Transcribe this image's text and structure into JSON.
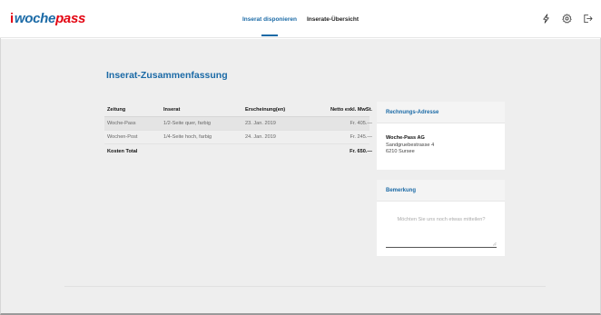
{
  "brand": {
    "prefix": "i",
    "part1": "woche",
    "part2": "pass"
  },
  "nav": {
    "tabs": [
      {
        "label": "Inserat disponieren",
        "active": true
      },
      {
        "label": "Inserate-Übersicht",
        "active": false
      }
    ]
  },
  "header_icons": [
    "lightning-icon",
    "gear-icon",
    "logout-icon"
  ],
  "page": {
    "title": "Inserat-Zusammenfassung"
  },
  "summary": {
    "headers": [
      "Zeitung",
      "Inserat",
      "Erscheinung(en)",
      "Netto exkl. MwSt."
    ],
    "rows": [
      {
        "zeitung": "Woche-Pass",
        "inserat": "1/2-Seite quer, farbig",
        "erscheinung": "23. Jan. 2019",
        "netto": "Fr. 405.—"
      },
      {
        "zeitung": "Wochen-Post",
        "inserat": "1/4-Seite hoch, farbig",
        "erscheinung": "24. Jan. 2019",
        "netto": "Fr. 245.—"
      }
    ],
    "total_label": "Kosten Total",
    "total_value": "Fr. 650.—"
  },
  "billing": {
    "title": "Rechnungs-Adresse",
    "company": "Woche-Pass AG",
    "street": "Sandgruebestrasse 4",
    "city": "6210 Sursee"
  },
  "remark": {
    "title": "Bemerkung",
    "placeholder": "Möchten Sie uns noch etwas mitteilen?",
    "value": ""
  },
  "colors": {
    "accent": "#1b6aa6",
    "brand_red": "#e30613",
    "background": "#eeeeee"
  }
}
